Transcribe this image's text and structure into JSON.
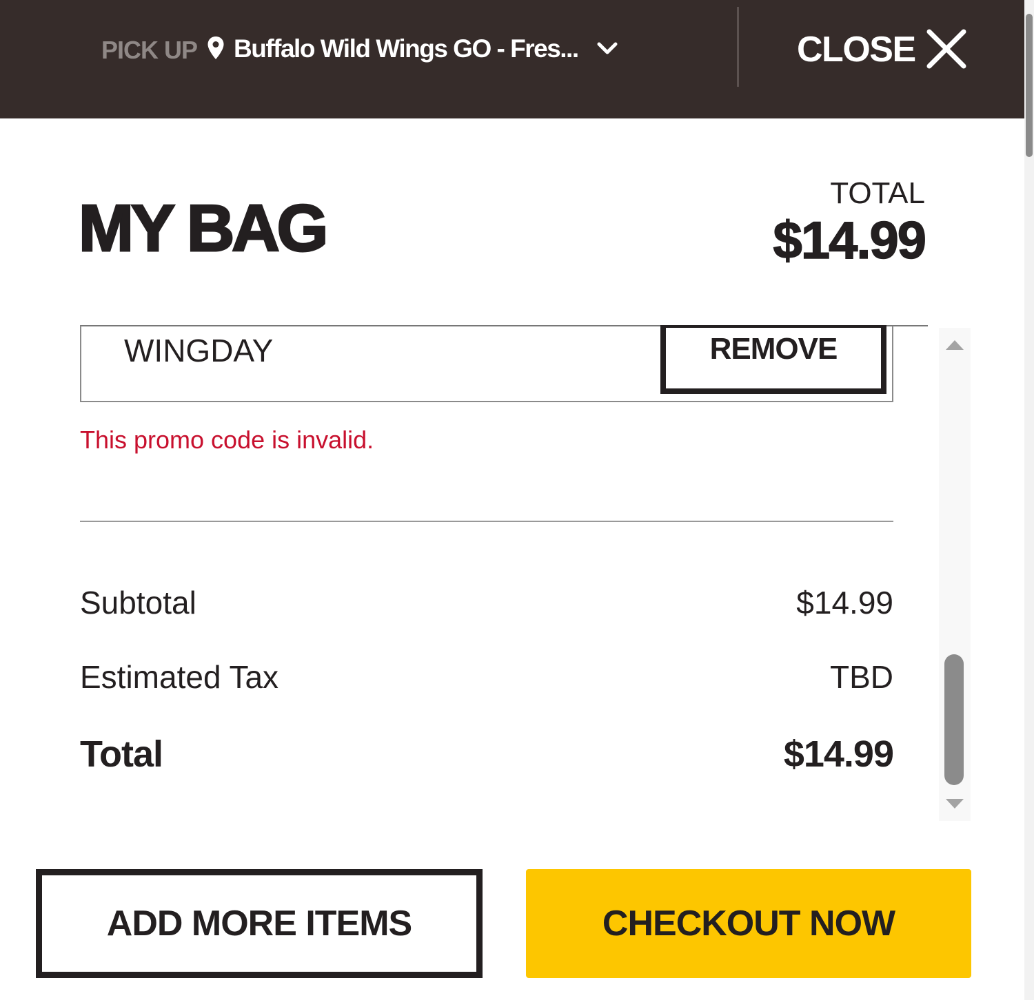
{
  "topbar": {
    "mode_label": "PICK UP",
    "location_name": "Buffalo Wild Wings GO - Fres...",
    "close_label": "CLOSE",
    "background_color": "#362c2a"
  },
  "header": {
    "title": "MY BAG",
    "total_caption": "TOTAL",
    "total_amount": "$14.99"
  },
  "promo": {
    "code": "WINGDAY",
    "remove_label": "REMOVE",
    "error_message": "This promo code is invalid.",
    "error_color": "#c8102e"
  },
  "summary": {
    "subtotal_label": "Subtotal",
    "subtotal_value": "$14.99",
    "tax_label": "Estimated Tax",
    "tax_value": "TBD",
    "total_label": "Total",
    "total_value": "$14.99"
  },
  "actions": {
    "add_more_label": "ADD MORE ITEMS",
    "checkout_label": "CHECKOUT NOW",
    "checkout_color": "#fdc600"
  },
  "icons": [
    "map-pin-icon",
    "chevron-down-icon",
    "close-icon",
    "scroll-up-arrow-icon",
    "scroll-down-arrow-icon"
  ]
}
